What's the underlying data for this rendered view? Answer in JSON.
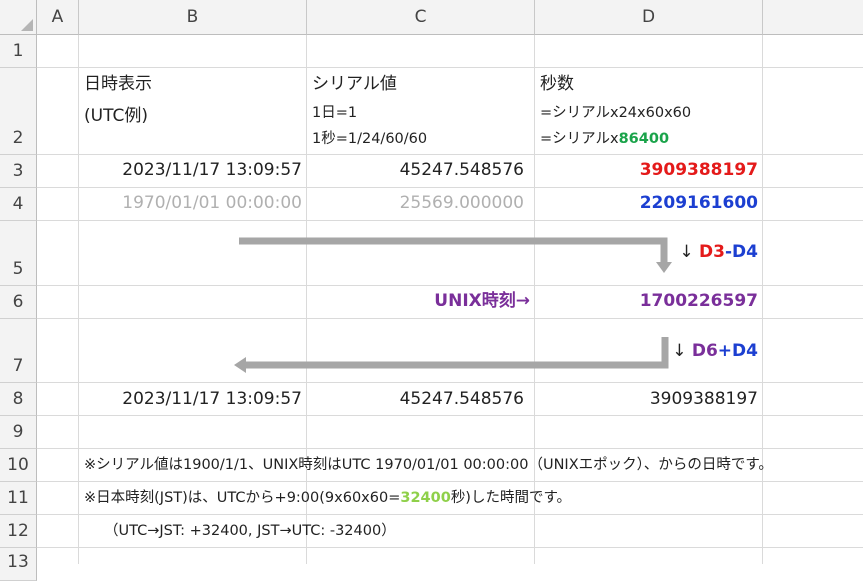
{
  "columns": [
    "A",
    "B",
    "C",
    "D"
  ],
  "rows": [
    "1",
    "2",
    "3",
    "4",
    "5",
    "6",
    "7",
    "8",
    "9",
    "10",
    "11",
    "12",
    "13"
  ],
  "header_row": {
    "b_line1": "日時表示",
    "b_line2": "(UTC例)",
    "c_line1": "シリアル値",
    "c_line2": "1日=1",
    "c_line3": "1秒=1/24/60/60",
    "d_line1": "秒数",
    "d_line2": "=シリアルx24x60x60",
    "d_line3_prefix": "=シリアルx",
    "d_line3_value": "86400"
  },
  "row3": {
    "datetime": "2023/11/17 13:09:57",
    "serial": "45247.548576",
    "seconds": "3909388197"
  },
  "row4": {
    "datetime": "1970/01/01 00:00:00",
    "serial": "25569.000000",
    "seconds": "2209161600"
  },
  "row5": {
    "arrow": "↓ ",
    "a": "D3",
    "op": "-",
    "b": "D4"
  },
  "row6": {
    "label": "UNIX時刻→",
    "value": "1700226597"
  },
  "row7": {
    "arrow": "↓ ",
    "a": "D6",
    "op": "+",
    "b": "D4"
  },
  "row8": {
    "datetime": "2023/11/17 13:09:57",
    "serial": "45247.548576",
    "seconds": "3909388197"
  },
  "notes": {
    "row10": "※シリアル値は1900/1/1、UNIX時刻はUTC 1970/01/01 00:00:00（UNIXエポック）、からの日時です。",
    "row11_prefix": "※日本時刻(JST)は、UTCから+9:00(9x60x60=",
    "row11_value": "32400",
    "row11_suffix": "秒)した時間です。",
    "row12": "（UTC→JST: +32400, JST→UTC: -32400）"
  },
  "colors": {
    "red": "#e41a1a",
    "blue": "#1c3fd1",
    "purple": "#7a2f9a",
    "green": "#1aa34a",
    "light_green": "#8fd04a",
    "arrow_grey": "#a6a6a6"
  }
}
